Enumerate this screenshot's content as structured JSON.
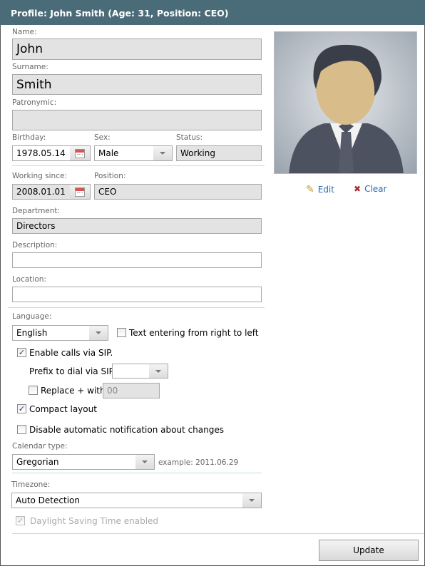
{
  "header": {
    "title": "Profile: John Smith (Age: 31, Position: CEO)"
  },
  "fields": {
    "name": {
      "label": "Name:",
      "value": "John"
    },
    "surname": {
      "label": "Surname:",
      "value": "Smith"
    },
    "patronymic": {
      "label": "Patronymic:",
      "value": ""
    },
    "birthday": {
      "label": "Birthday:",
      "value": "1978.05.14"
    },
    "sex": {
      "label": "Sex:",
      "value": "Male"
    },
    "status": {
      "label": "Status:",
      "value": "Working"
    },
    "working_since": {
      "label": "Working since:",
      "value": "2008.01.01"
    },
    "position": {
      "label": "Position:",
      "value": "CEO"
    },
    "department": {
      "label": "Department:",
      "value": "Directors"
    },
    "description": {
      "label": "Description:",
      "value": ""
    },
    "location": {
      "label": "Location:",
      "value": ""
    }
  },
  "photo": {
    "edit_label": "Edit",
    "clear_label": "Clear"
  },
  "settings": {
    "language": {
      "label": "Language:",
      "value": "English"
    },
    "rtl": {
      "label": "Text entering from right to left",
      "checked": false
    },
    "sip": {
      "label": "Enable calls via SIP.",
      "checked": true
    },
    "sip_prefix": {
      "label": "Prefix to dial via SIP:",
      "value": ""
    },
    "replace_plus": {
      "label": "Replace + with",
      "checked": false,
      "value": "00"
    },
    "compact": {
      "label": "Compact layout",
      "checked": true
    },
    "disable_notify": {
      "label": "Disable automatic notification about changes",
      "checked": false
    },
    "calendar": {
      "label": "Calendar type:",
      "value": "Gregorian",
      "example": "example: 2011.06.29"
    },
    "timezone": {
      "label": "Timezone:",
      "value": "Auto Detection"
    },
    "dst": {
      "label": "Daylight Saving Time enabled",
      "checked": true,
      "disabled": true
    }
  },
  "footer": {
    "update_label": "Update"
  },
  "icons": {
    "check": "✓",
    "edit": "✎",
    "clear": "✖"
  },
  "colors": {
    "header_bg": "#4a6b78",
    "link": "#2a6ab0",
    "separator": "#c5dde3"
  }
}
